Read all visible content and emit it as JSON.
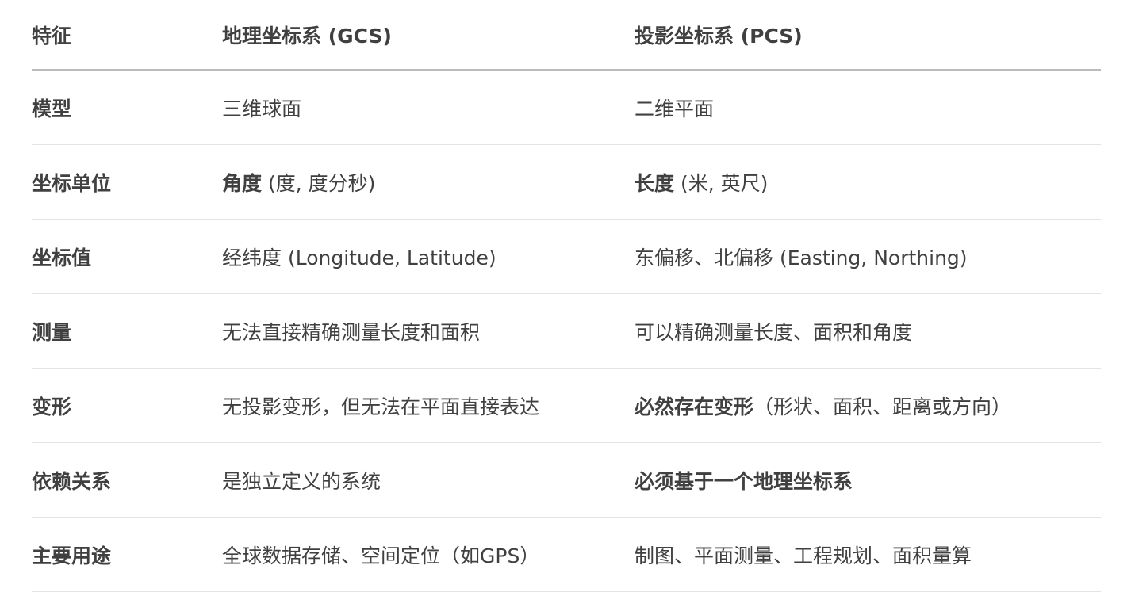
{
  "headers": [
    "特征",
    "地理坐标系 (GCS)",
    "投影坐标系 (PCS)"
  ],
  "rows": [
    {
      "feature": "模型",
      "gcs": [
        {
          "t": "三维球面"
        }
      ],
      "pcs": [
        {
          "t": "二维平面"
        }
      ]
    },
    {
      "feature": "坐标单位",
      "gcs": [
        {
          "t": "角度",
          "b": true
        },
        {
          "t": " (度, 度分秒)"
        }
      ],
      "pcs": [
        {
          "t": "长度",
          "b": true
        },
        {
          "t": " (米, 英尺)"
        }
      ]
    },
    {
      "feature": "坐标值",
      "gcs": [
        {
          "t": "经纬度 (Longitude, Latitude)"
        }
      ],
      "pcs": [
        {
          "t": "东偏移、北偏移 (Easting, Northing)"
        }
      ]
    },
    {
      "feature": "测量",
      "gcs": [
        {
          "t": "无法直接精确测量长度和面积"
        }
      ],
      "pcs": [
        {
          "t": "可以精确测量长度、面积和角度"
        }
      ]
    },
    {
      "feature": "变形",
      "gcs": [
        {
          "t": "无投影变形，但无法在平面直接表达"
        }
      ],
      "pcs": [
        {
          "t": "必然存在变形",
          "b": true
        },
        {
          "t": "（形状、面积、距离或方向）"
        }
      ]
    },
    {
      "feature": "依赖关系",
      "gcs": [
        {
          "t": "是独立定义的系统"
        }
      ],
      "pcs": [
        {
          "t": "必须基于一个地理坐标系",
          "b": true
        }
      ]
    },
    {
      "feature": "主要用途",
      "gcs": [
        {
          "t": "全球数据存储、空间定位（如GPS）"
        }
      ],
      "pcs": [
        {
          "t": "制图、平面测量、工程规划、面积量算"
        }
      ]
    }
  ]
}
